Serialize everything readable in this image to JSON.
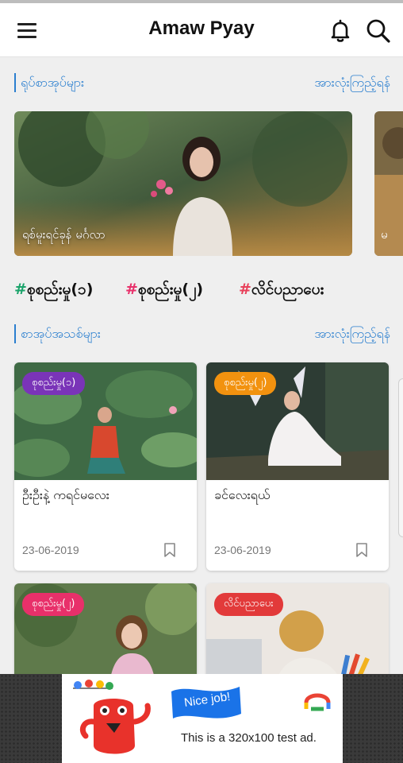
{
  "app": {
    "title": "Amaw Pyay"
  },
  "sections": {
    "popular": {
      "title": "ရုပ်စာအုပ်များ",
      "view_all": "အားလုံးကြည့်ရန်"
    },
    "new": {
      "title": "စာအုပ်အသစ်များ",
      "view_all": "အားလုံးကြည့်ရန်"
    }
  },
  "hero": [
    {
      "caption": "ရစ်မူးရင်ခုန် မင်္ဂလာ"
    },
    {
      "caption": "မ"
    }
  ],
  "tags": [
    {
      "hash": "#",
      "label": "စုစည်းမှု(၁)",
      "color": "#1aa36a"
    },
    {
      "hash": "#",
      "label": "စုစည်းမှု(၂)",
      "color": "#e8306a"
    },
    {
      "hash": "#",
      "label": "လိင်ပညာပေး",
      "color": "#e8405a"
    }
  ],
  "cards": [
    {
      "badge": "စုစည်းမှု(၁)",
      "badge_color": "#7a34b8",
      "title": "ဦးဦးနဲ့ ကရင်မလေး",
      "date": "23-06-2019"
    },
    {
      "badge": "စုစည်းမှု(၂)",
      "badge_color": "#f2920f",
      "title": "ခင်လေးရယ်",
      "date": "23-06-2019"
    },
    {
      "badge": "စုစည်းမှု(၂)",
      "badge_color": "#e8306a",
      "title": "",
      "date": ""
    },
    {
      "badge": "လိင်ပညာပေး",
      "badge_color": "#e23a3a",
      "title": "",
      "date": ""
    }
  ],
  "ad": {
    "flag_text": "Nice job!",
    "text": "This is a 320x100 test ad."
  },
  "icons": {
    "menu": "menu-icon",
    "bell": "bell-icon",
    "search": "search-icon",
    "bookmark": "bookmark-icon"
  }
}
